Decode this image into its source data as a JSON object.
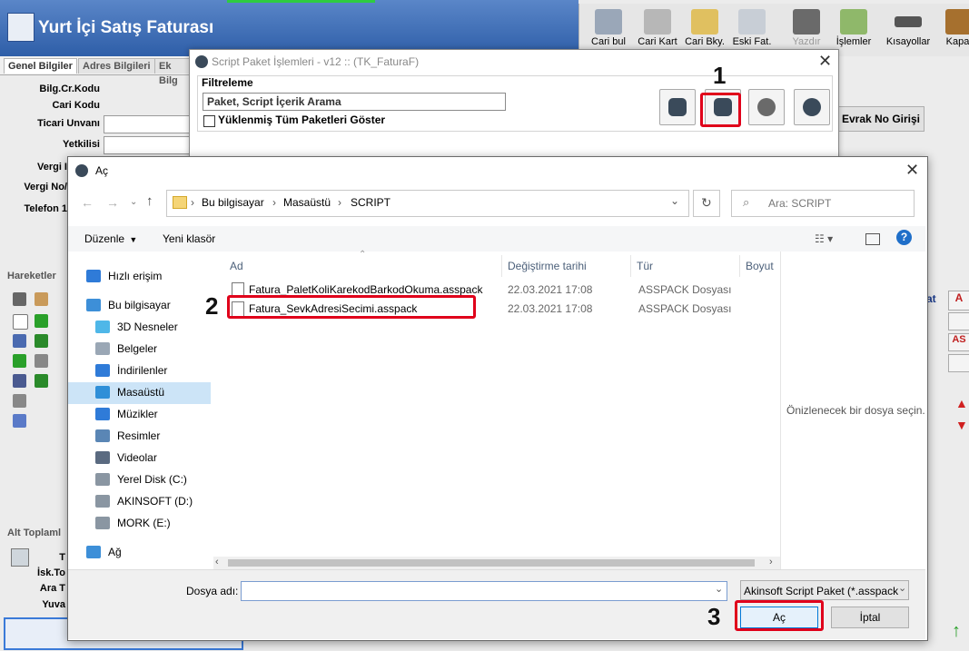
{
  "app": {
    "title": "Yurt İçi Satış Faturası",
    "toolbar": [
      {
        "label": "Cari bul",
        "icon": "person-search-icon"
      },
      {
        "label": "Cari Kart",
        "icon": "person-card-icon"
      },
      {
        "label": "Cari Bky.",
        "icon": "person-balance-icon"
      },
      {
        "label": "Eski Fat.",
        "icon": "old-invoice-icon"
      },
      {
        "label": "Yazdır",
        "icon": "printer-icon"
      },
      {
        "label": "İşlemler",
        "icon": "operations-icon"
      },
      {
        "label": "Kısayollar",
        "icon": "keyboard-icon"
      },
      {
        "label": "Kapat",
        "icon": "door-icon"
      }
    ],
    "tabs": [
      "Genel Bilgiler",
      "Adres Bilgileri",
      "Ek Bilg"
    ],
    "fields": [
      "Bilg.Cr.Kodu",
      "Cari Kodu",
      "Ticari Unvanı",
      "Yetkilisi",
      "Vergi I",
      "Vergi No/",
      "Telefon 1"
    ],
    "evrak_button": "Evrak No Girişi",
    "section_hareketler": "Hareketler",
    "section_alt": "Alt Toplaml",
    "alt_fields": [
      "T",
      "İsk.To",
      "Ara T",
      "Yuva"
    ],
    "right_side_labels": [
      "at",
      "A",
      "AS"
    ]
  },
  "script_dialog": {
    "title": "Script Paket İşlemleri - v12 :: (TK_FaturaF)",
    "group_label": "Filtreleme",
    "search_value": "Paket, Script İçerik Arama",
    "checkbox_label": "Yüklenmiş Tüm Paketleri Göster",
    "buttons": [
      "add-package-icon",
      "import-package-icon",
      "cloud-download-icon",
      "reset-icon"
    ]
  },
  "open_dialog": {
    "title": "Aç",
    "breadcrumb": [
      "Bu bilgisayar",
      "Masaüstü",
      "SCRIPT"
    ],
    "search_placeholder": "Ara: SCRIPT",
    "organize": "Düzenle",
    "new_folder": "Yeni klasör",
    "nav_items": [
      {
        "label": "Hızlı erişim",
        "icon": "star-icon",
        "color": "#2f7bd8"
      },
      {
        "label": "Bu bilgisayar",
        "icon": "computer-icon",
        "color": "#3d8fd8"
      },
      {
        "label": "3D Nesneler",
        "icon": "cube-icon",
        "color": "#4fb7e8"
      },
      {
        "label": "Belgeler",
        "icon": "document-icon",
        "color": "#9aa7b5"
      },
      {
        "label": "İndirilenler",
        "icon": "download-arrow-icon",
        "color": "#2f7bd8"
      },
      {
        "label": "Masaüstü",
        "icon": "desktop-icon",
        "color": "#2f8fd8"
      },
      {
        "label": "Müzikler",
        "icon": "music-icon",
        "color": "#2f7bd8"
      },
      {
        "label": "Resimler",
        "icon": "pictures-icon",
        "color": "#5a86b5"
      },
      {
        "label": "Videolar",
        "icon": "video-icon",
        "color": "#5a6a80"
      },
      {
        "label": "Yerel Disk (C:)",
        "icon": "disk-icon",
        "color": "#8a96a2"
      },
      {
        "label": "AKINSOFT (D:)",
        "icon": "disk-icon",
        "color": "#8a96a2"
      },
      {
        "label": "MORK (E:)",
        "icon": "disk-icon",
        "color": "#8a96a2"
      },
      {
        "label": "Ağ",
        "icon": "network-icon",
        "color": "#3d8fd8"
      }
    ],
    "selected_nav": "Masaüstü",
    "columns": [
      "Ad",
      "Değiştirme tarihi",
      "Tür",
      "Boyut"
    ],
    "files": [
      {
        "name": "Fatura_PaletKoliKarekodBarkodOkuma.asspack",
        "date": "22.03.2021 17:08",
        "type": "ASSPACK Dosyası"
      },
      {
        "name": "Fatura_SevkAdresiSecimi.asspack",
        "date": "22.03.2021 17:08",
        "type": "ASSPACK Dosyası"
      }
    ],
    "preview_text": "Önizlenecek bir dosya seçin.",
    "filename_label": "Dosya adı:",
    "filename_value": "",
    "filter": "Akinsoft Script Paket (*.asspack",
    "open_button": "Aç",
    "cancel_button": "İptal"
  },
  "annotations": [
    "1",
    "2",
    "3"
  ],
  "colors": {
    "highlight": "#e0001a",
    "title_blue": "#2e5ea8",
    "nav_selected": "#cce4f7"
  }
}
